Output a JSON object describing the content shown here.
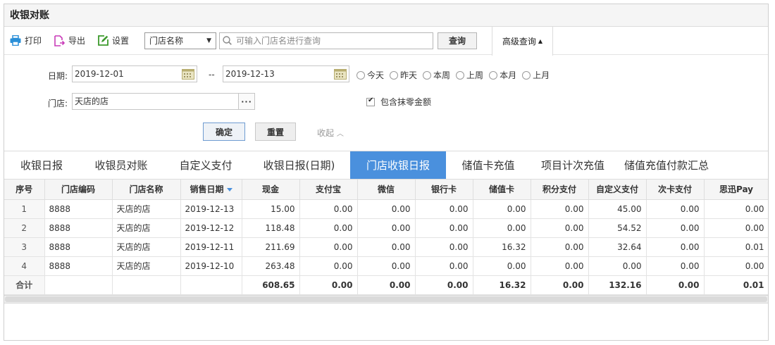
{
  "window": {
    "title": "收银对账"
  },
  "toolbar": {
    "print_label": "打印",
    "export_label": "导出",
    "settings_label": "设置",
    "field_select": "门店名称",
    "search_placeholder": "可输入门店名进行查询",
    "query_label": "查询",
    "advanced_label": "高级查询"
  },
  "filter": {
    "date_label": "日期:",
    "date_from": "2019-12-01",
    "date_sep": "--",
    "date_to": "2019-12-13",
    "quick_ranges": [
      "今天",
      "昨天",
      "本周",
      "上周",
      "本月",
      "上月"
    ],
    "store_label": "门店:",
    "store_value": "天店的店",
    "store_more": "···",
    "include_rounding_label": "包含抹零金额",
    "confirm_label": "确定",
    "reset_label": "重置",
    "collapse_label": "收起"
  },
  "tabs": [
    "收银日报",
    "收银员对账",
    "自定义支付",
    "收银日报(日期)",
    "门店收银日报",
    "储值卡充值",
    "项目计次充值",
    "储值充值付款汇总"
  ],
  "active_tab": 4,
  "table": {
    "columns": [
      "序号",
      "门店编码",
      "门店名称",
      "销售日期",
      "现金",
      "支付宝",
      "微信",
      "银行卡",
      "储值卡",
      "积分支付",
      "自定义支付",
      "次卡支付",
      "思迅Pay"
    ],
    "rows": [
      [
        "1",
        "8888",
        "天店的店",
        "2019-12-13",
        "15.00",
        "0.00",
        "0.00",
        "0.00",
        "0.00",
        "0.00",
        "45.00",
        "0.00",
        "0.00"
      ],
      [
        "2",
        "8888",
        "天店的店",
        "2019-12-12",
        "118.48",
        "0.00",
        "0.00",
        "0.00",
        "0.00",
        "0.00",
        "54.52",
        "0.00",
        "0.00"
      ],
      [
        "3",
        "8888",
        "天店的店",
        "2019-12-11",
        "211.69",
        "0.00",
        "0.00",
        "0.00",
        "16.32",
        "0.00",
        "32.64",
        "0.00",
        "0.01"
      ],
      [
        "4",
        "8888",
        "天店的店",
        "2019-12-10",
        "263.48",
        "0.00",
        "0.00",
        "0.00",
        "0.00",
        "0.00",
        "0.00",
        "0.00",
        "0.00"
      ]
    ],
    "total": [
      "合计",
      "",
      "",
      "",
      "608.65",
      "0.00",
      "0.00",
      "0.00",
      "16.32",
      "0.00",
      "132.16",
      "0.00",
      "0.01"
    ]
  },
  "colors": {
    "accent": "#4a90dd",
    "print_icon": "#2a8fd8",
    "export_icon": "#c83bb8",
    "settings_icon": "#3c9a2c"
  }
}
